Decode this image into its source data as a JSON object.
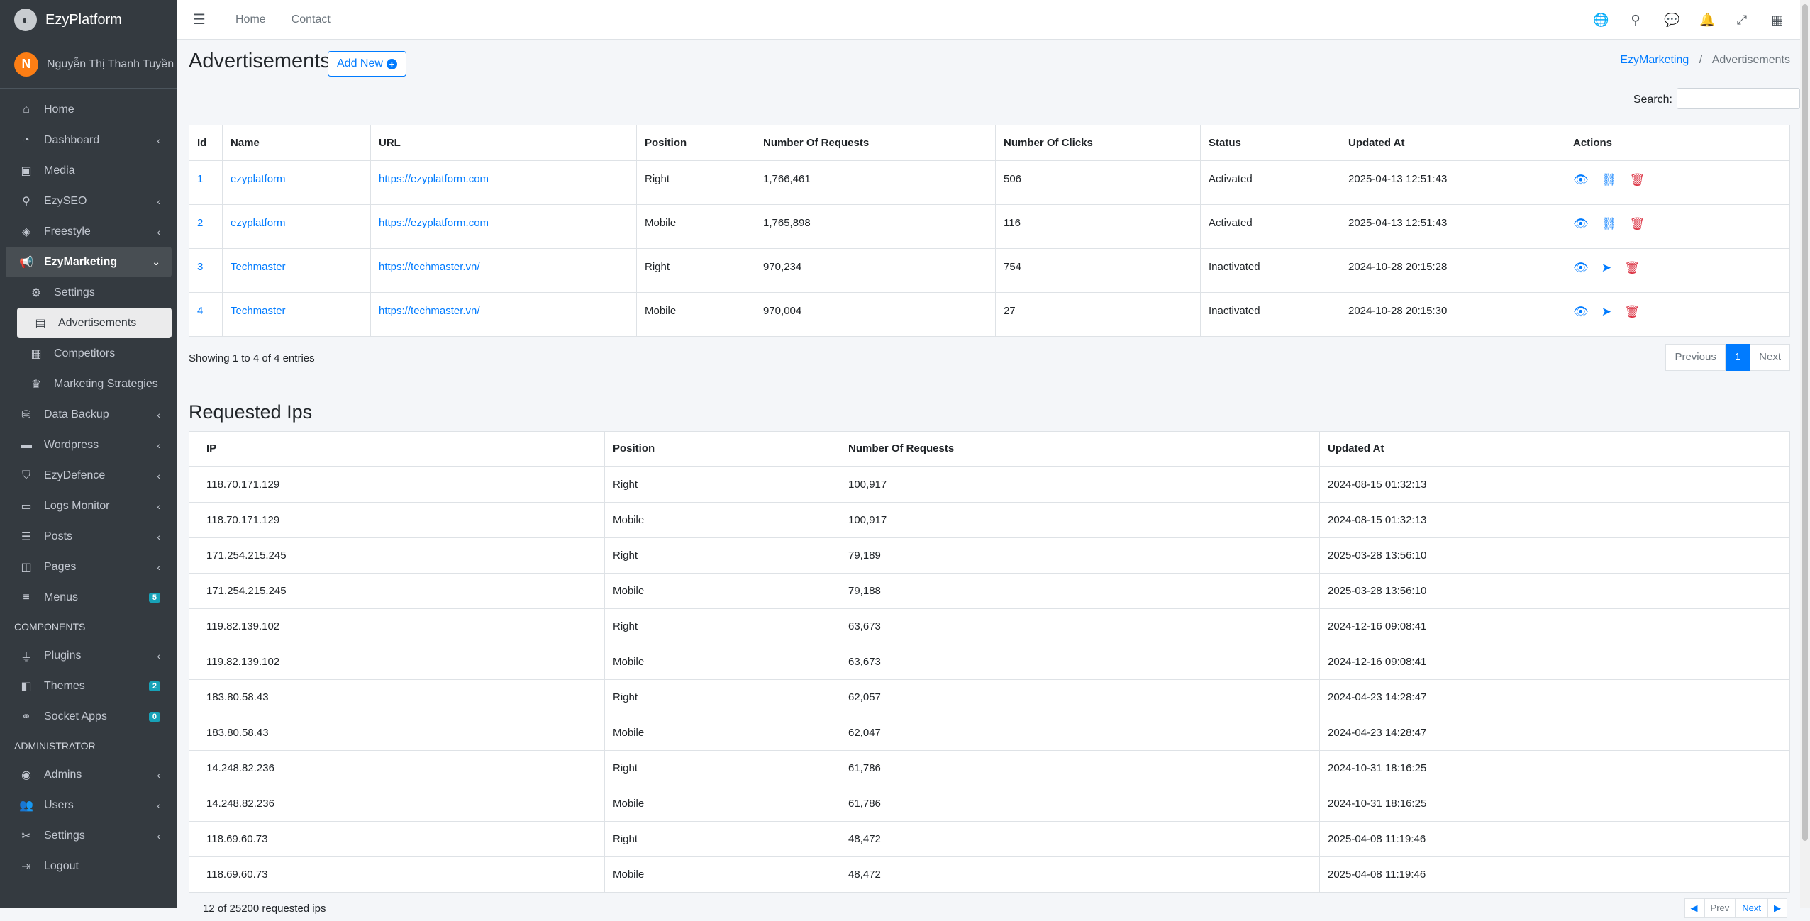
{
  "brand": {
    "name": "EzyPlatform"
  },
  "user": {
    "initial": "N",
    "name": "Nguyễn Thị Thanh Tuyền"
  },
  "sidebar": {
    "items": [
      {
        "label": "Home",
        "icon": "home-icon"
      },
      {
        "label": "Dashboard",
        "icon": "dashboard-icon"
      },
      {
        "label": "Media",
        "icon": "image-icon"
      },
      {
        "label": "EzySEO",
        "icon": "search-icon"
      },
      {
        "label": "Freestyle",
        "icon": "layers-icon"
      },
      {
        "label": "EzyMarketing",
        "icon": "megaphone-icon"
      },
      {
        "label": "Settings",
        "icon": "gear-icon"
      },
      {
        "label": "Advertisements",
        "icon": "ad-icon"
      },
      {
        "label": "Competitors",
        "icon": "grid-icon"
      },
      {
        "label": "Marketing Strategies",
        "icon": "crown-icon"
      },
      {
        "label": "Data Backup",
        "icon": "database-icon"
      },
      {
        "label": "Wordpress",
        "icon": "wordpress-icon"
      },
      {
        "label": "EzyDefence",
        "icon": "shield-icon"
      },
      {
        "label": "Logs Monitor",
        "icon": "terminal-icon"
      },
      {
        "label": "Posts",
        "icon": "posts-icon"
      },
      {
        "label": "Pages",
        "icon": "pages-icon"
      },
      {
        "label": "Menus",
        "icon": "menu-icon",
        "badge": "5"
      }
    ],
    "header_components": "COMPONENTS",
    "components": [
      {
        "label": "Plugins",
        "icon": "plug-icon"
      },
      {
        "label": "Themes",
        "icon": "themes-icon",
        "badge": "2"
      },
      {
        "label": "Socket Apps",
        "icon": "socket-icon",
        "badge": "0"
      }
    ],
    "header_admin": "ADMINISTRATOR",
    "admin": [
      {
        "label": "Admins",
        "icon": "user-circle-icon"
      },
      {
        "label": "Users",
        "icon": "users-icon"
      },
      {
        "label": "Settings",
        "icon": "tools-icon"
      },
      {
        "label": "Logout",
        "icon": "logout-icon"
      }
    ]
  },
  "topbar": {
    "home": "Home",
    "contact": "Contact"
  },
  "page": {
    "title": "Advertisements",
    "add_new": "Add New",
    "breadcrumb_parent": "EzyMarketing",
    "breadcrumb_current": "Advertisements",
    "search_label": "Search:",
    "search_value": ""
  },
  "ads_table": {
    "headers": [
      "Id",
      "Name",
      "URL",
      "Position",
      "Number Of Requests",
      "Number Of Clicks",
      "Status",
      "Updated At",
      "Actions"
    ],
    "rows": [
      {
        "id": "1",
        "name": "ezyplatform",
        "url": "https://ezyplatform.com",
        "position": "Right",
        "requests": "1,766,461",
        "clicks": "506",
        "status": "Activated",
        "updated": "2025-04-13 12:51:43"
      },
      {
        "id": "2",
        "name": "ezyplatform",
        "url": "https://ezyplatform.com",
        "position": "Mobile",
        "requests": "1,765,898",
        "clicks": "116",
        "status": "Activated",
        "updated": "2025-04-13 12:51:43"
      },
      {
        "id": "3",
        "name": "Techmaster",
        "url": "https://techmaster.vn/",
        "position": "Right",
        "requests": "970,234",
        "clicks": "754",
        "status": "Inactivated",
        "updated": "2024-10-28 20:15:28"
      },
      {
        "id": "4",
        "name": "Techmaster",
        "url": "https://techmaster.vn/",
        "position": "Mobile",
        "requests": "970,004",
        "clicks": "27",
        "status": "Inactivated",
        "updated": "2024-10-28 20:15:30"
      }
    ],
    "info": "Showing 1 to 4 of 4 entries",
    "prev": "Previous",
    "page": "1",
    "next": "Next"
  },
  "ips_section": {
    "title": "Requested Ips",
    "headers": [
      "IP",
      "Position",
      "Number Of Requests",
      "Updated At"
    ],
    "rows": [
      {
        "ip": "118.70.171.129",
        "position": "Right",
        "requests": "100,917",
        "updated": "2024-08-15 01:32:13"
      },
      {
        "ip": "118.70.171.129",
        "position": "Mobile",
        "requests": "100,917",
        "updated": "2024-08-15 01:32:13"
      },
      {
        "ip": "171.254.215.245",
        "position": "Right",
        "requests": "79,189",
        "updated": "2025-03-28 13:56:10"
      },
      {
        "ip": "171.254.215.245",
        "position": "Mobile",
        "requests": "79,188",
        "updated": "2025-03-28 13:56:10"
      },
      {
        "ip": "119.82.139.102",
        "position": "Right",
        "requests": "63,673",
        "updated": "2024-12-16 09:08:41"
      },
      {
        "ip": "119.82.139.102",
        "position": "Mobile",
        "requests": "63,673",
        "updated": "2024-12-16 09:08:41"
      },
      {
        "ip": "183.80.58.43",
        "position": "Right",
        "requests": "62,057",
        "updated": "2024-04-23 14:28:47"
      },
      {
        "ip": "183.80.58.43",
        "position": "Mobile",
        "requests": "62,047",
        "updated": "2024-04-23 14:28:47"
      },
      {
        "ip": "14.248.82.236",
        "position": "Right",
        "requests": "61,786",
        "updated": "2024-10-31 18:16:25"
      },
      {
        "ip": "14.248.82.236",
        "position": "Mobile",
        "requests": "61,786",
        "updated": "2024-10-31 18:16:25"
      },
      {
        "ip": "118.69.60.73",
        "position": "Right",
        "requests": "48,472",
        "updated": "2025-04-08 11:19:46"
      },
      {
        "ip": "118.69.60.73",
        "position": "Mobile",
        "requests": "48,472",
        "updated": "2025-04-08 11:19:46"
      }
    ],
    "info": "12 of 25200 requested ips",
    "prev": "Prev",
    "next": "Next"
  }
}
